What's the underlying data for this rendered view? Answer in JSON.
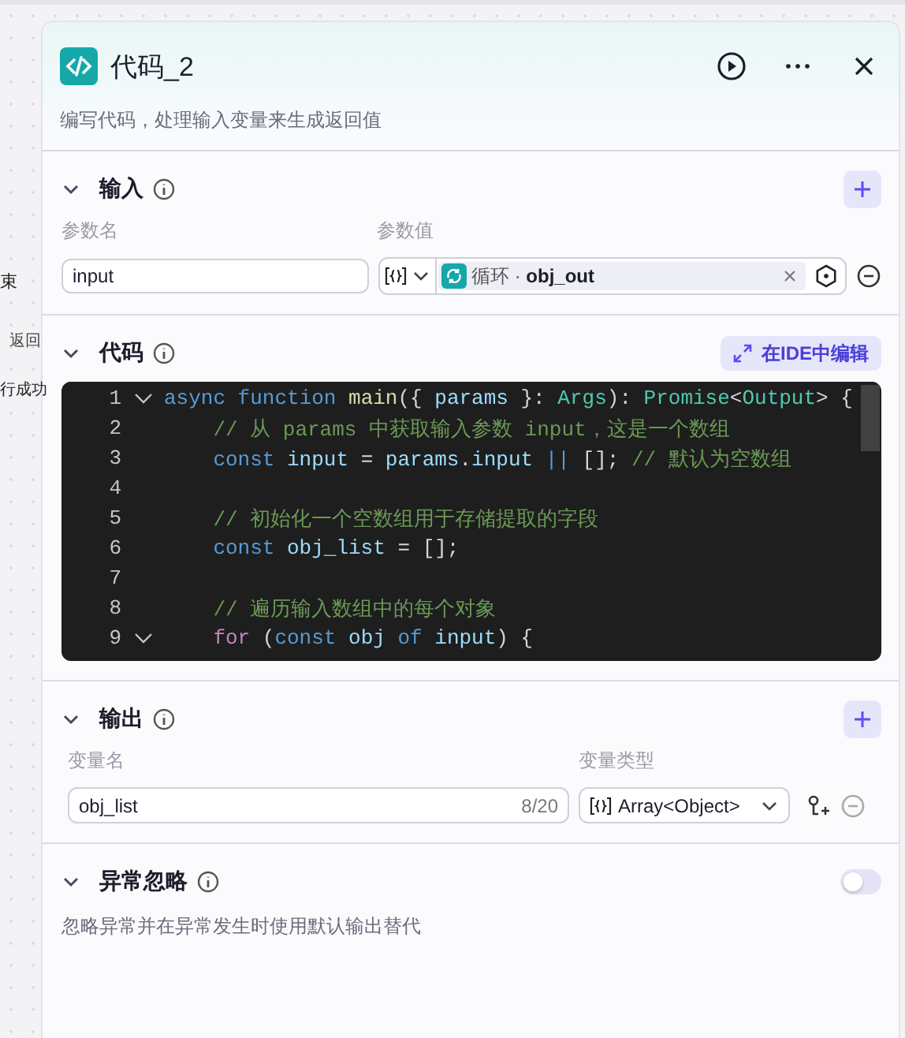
{
  "background_nodes": [
    {
      "text": "束"
    },
    {
      "text": "返回"
    },
    {
      "text": "行成功"
    }
  ],
  "panel": {
    "title": "代码_2",
    "description": "编写代码，处理输入变量来生成返回值"
  },
  "input_section": {
    "title": "输入",
    "expanded": true,
    "name_label": "参数名",
    "value_label": "参数值",
    "params": [
      {
        "name": "input",
        "source": "循环 ·",
        "variable": "obj_out"
      }
    ]
  },
  "code_section": {
    "title": "代码",
    "expanded": true,
    "ide_button": "在IDE中编辑",
    "lines": [
      {
        "number": "1",
        "fold": true,
        "tokens": [
          {
            "kind": "keyword",
            "text": "async function"
          },
          {
            "kind": "func",
            "text": " main"
          },
          {
            "kind": "plain",
            "text": "({ "
          },
          {
            "kind": "var",
            "text": "params"
          },
          {
            "kind": "plain",
            "text": " }: "
          },
          {
            "kind": "type",
            "text": "Args"
          },
          {
            "kind": "plain",
            "text": "): "
          },
          {
            "kind": "type",
            "text": "Promise"
          },
          {
            "kind": "plain",
            "text": "<"
          },
          {
            "kind": "type",
            "text": "Output"
          },
          {
            "kind": "plain",
            "text": "> {"
          }
        ],
        "children": [
          {
            "number": "2",
            "fold": false,
            "tokens": [
              {
                "kind": "comment",
                "text": "// 从 params 中获取输入参数 input，这是一个数组"
              }
            ]
          },
          {
            "number": "3",
            "fold": false,
            "tokens": [
              {
                "kind": "keyword",
                "text": "const"
              },
              {
                "kind": "var",
                "text": " input"
              },
              {
                "kind": "plain",
                "text": " = "
              },
              {
                "kind": "var",
                "text": "params"
              },
              {
                "kind": "plain",
                "text": "."
              },
              {
                "kind": "var",
                "text": "input"
              },
              {
                "kind": "keyword",
                "text": " ||"
              },
              {
                "kind": "plain",
                "text": " []; "
              },
              {
                "kind": "comment",
                "text": "// 默认为空数组"
              }
            ]
          },
          {
            "number": "4",
            "fold": false
          },
          {
            "number": "5",
            "fold": false,
            "tokens": [
              {
                "kind": "comment",
                "text": "// 初始化一个空数组用于存储提取的字段"
              }
            ]
          },
          {
            "number": "6",
            "fold": false,
            "tokens": [
              {
                "kind": "keyword",
                "text": "const"
              },
              {
                "kind": "var",
                "text": " obj_list"
              },
              {
                "kind": "plain",
                "text": " = [];"
              }
            ]
          },
          {
            "number": "7",
            "fold": false
          },
          {
            "number": "8",
            "fold": false,
            "tokens": [
              {
                "kind": "comment",
                "text": "// 遍历输入数组中的每个对象"
              }
            ]
          },
          {
            "number": "9",
            "fold": true,
            "tokens": [
              {
                "kind": "control",
                "text": "for"
              },
              {
                "kind": "plain",
                "text": " ("
              },
              {
                "kind": "keyword",
                "text": "const"
              },
              {
                "kind": "var",
                "text": " obj"
              },
              {
                "kind": "keyword",
                "text": " of"
              },
              {
                "kind": "var",
                "text": " input"
              },
              {
                "kind": "plain",
                "text": ") {"
              }
            ]
          }
        ]
      }
    ]
  },
  "output_section": {
    "title": "输出",
    "expanded": true,
    "name_label": "变量名",
    "type_label": "变量类型",
    "outputs": [
      {
        "name": "obj_list",
        "counter": "8/20",
        "type": "Array<Object>"
      }
    ]
  },
  "exception_section": {
    "title": "异常忽略",
    "expanded": true,
    "on": false,
    "description": "忽略异常并在异常发生时使用默认输出替代"
  }
}
